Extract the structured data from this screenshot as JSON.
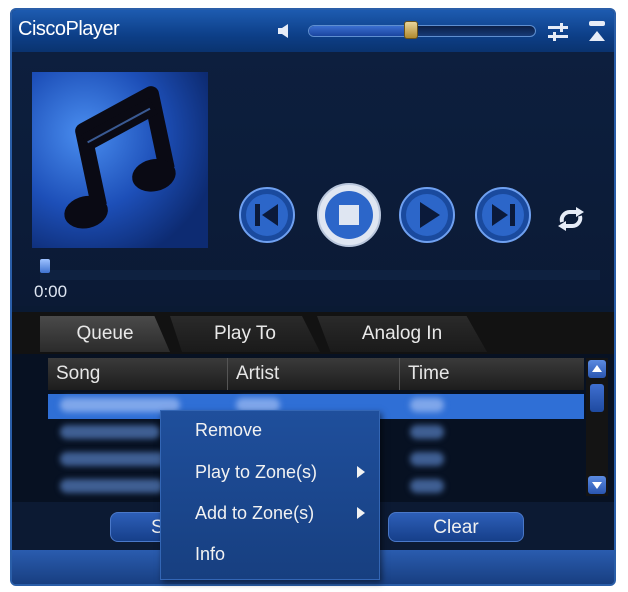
{
  "window": {
    "title": "CiscoPlayer"
  },
  "volume": {
    "level": 0.45
  },
  "player": {
    "time": "0:00",
    "progress": 0.0
  },
  "icons": {
    "speaker": "speaker-icon",
    "equalizer": "equalizer-icon",
    "collapse": "collapse-icon",
    "previous": "previous-track-icon",
    "stop": "stop-icon",
    "play": "play-icon",
    "next": "next-track-icon",
    "repeat": "repeat-icon",
    "album_art": "music-note-icon"
  },
  "tabs": [
    {
      "label": "Queue",
      "active": true
    },
    {
      "label": "Play To",
      "active": false
    },
    {
      "label": "Analog In",
      "active": false
    }
  ],
  "table": {
    "columns": [
      "Song",
      "Artist",
      "Time"
    ]
  },
  "buttons": {
    "left_partial": "S",
    "clear": "Clear"
  },
  "context_menu": {
    "items": [
      {
        "label": "Remove",
        "submenu": false
      },
      {
        "label": "Play to Zone(s)",
        "submenu": true
      },
      {
        "label": "Add to Zone(s)",
        "submenu": true
      },
      {
        "label": "Info",
        "submenu": false
      }
    ]
  },
  "colors": {
    "accent": "#1d5bb0",
    "selection": "#2f6fd6",
    "menu_bg": "#1f4f9c"
  }
}
